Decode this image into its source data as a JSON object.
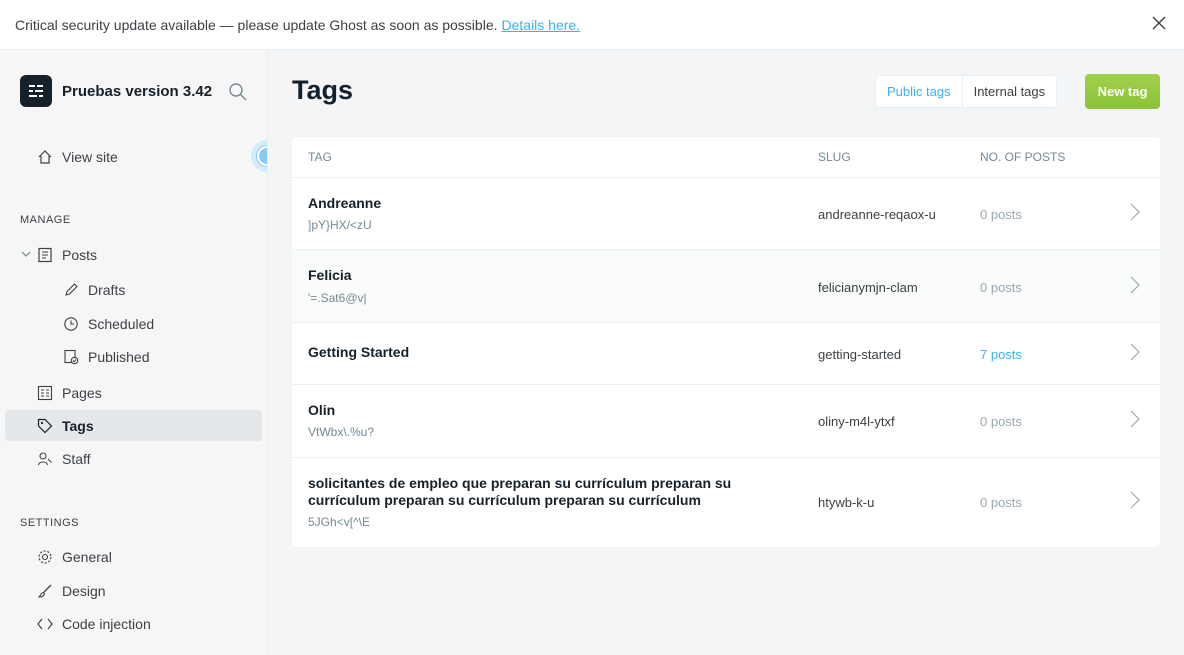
{
  "banner": {
    "message": "Critical security update available — please update Ghost as soon as possible.",
    "link": "Details here."
  },
  "sidebar": {
    "site_title": "Pruebas version 3.42",
    "view_site": "View site",
    "manage_label": "MANAGE",
    "settings_label": "SETTINGS",
    "items": {
      "posts": "Posts",
      "drafts": "Drafts",
      "scheduled": "Scheduled",
      "published": "Published",
      "pages": "Pages",
      "tags": "Tags",
      "staff": "Staff",
      "general": "General",
      "design": "Design",
      "code_injection": "Code injection"
    }
  },
  "header": {
    "title": "Tags",
    "public_tags": "Public tags",
    "internal_tags": "Internal tags",
    "new_tag": "New tag"
  },
  "table": {
    "columns": {
      "tag": "TAG",
      "slug": "SLUG",
      "posts": "NO. OF POSTS"
    },
    "rows": [
      {
        "name": "Andreanne",
        "desc": "]pY}HX/<zU",
        "slug": "andreanne-reqaox-u",
        "count": "0 posts"
      },
      {
        "name": "Felicia",
        "desc": "'=.Sat6@v|",
        "slug": "felicianymjn-clam",
        "count": "0 posts"
      },
      {
        "name": "Getting Started",
        "desc": "",
        "slug": "getting-started",
        "count": "7 posts"
      },
      {
        "name": "Olin",
        "desc": "VtWbx\\.%u?",
        "slug": "oliny-m4l-ytxf",
        "count": "0 posts"
      },
      {
        "name": "solicitantes de empleo que preparan su currículum preparan su currículum preparan su currículum preparan su currículum",
        "desc": "5JGh<v[^\\E",
        "slug": "htywb-k-u",
        "count": "0 posts"
      }
    ]
  },
  "colors": {
    "accent": "#3eb0ef",
    "primary_button": "#97ca42",
    "text_dark": "#15212a",
    "muted": "#738a94"
  }
}
